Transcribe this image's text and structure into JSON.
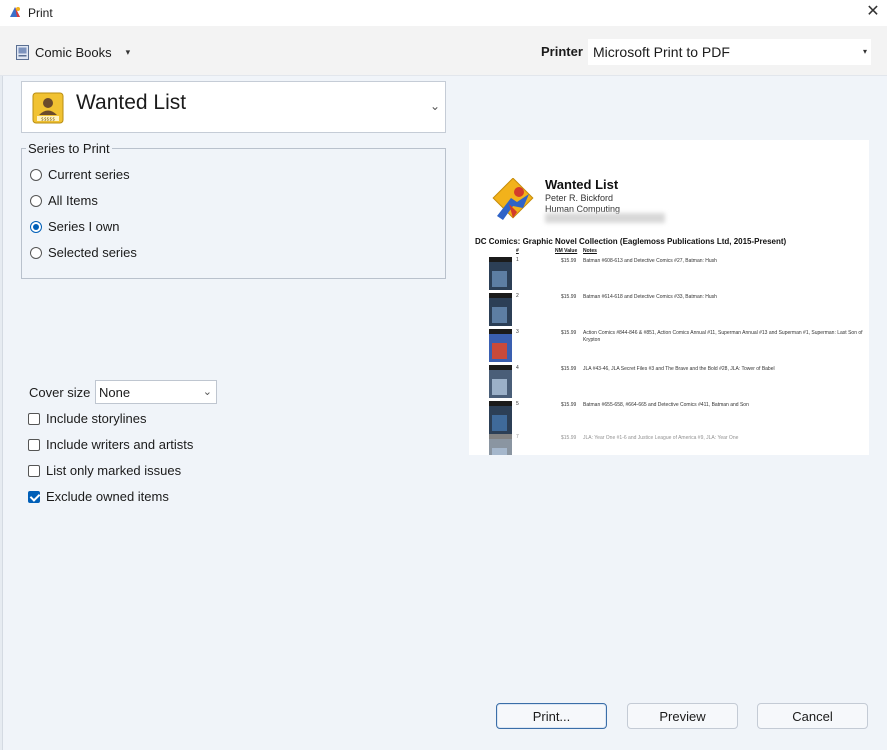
{
  "window": {
    "title": "Print",
    "close_glyph": "✕"
  },
  "toolbar": {
    "collection_label": "Comic Books",
    "collection_caret": "▾",
    "printer_label": "Printer",
    "printer_value": "Microsoft Print to PDF",
    "printer_caret": "▾"
  },
  "report": {
    "selected": "Wanted List",
    "caret": "⌄"
  },
  "series_to_print": {
    "title": "Series to Print",
    "options": [
      {
        "label": "Current series",
        "selected": false
      },
      {
        "label": "All Items",
        "selected": false
      },
      {
        "label": "Series I own",
        "selected": true
      },
      {
        "label": "Selected series",
        "selected": false
      }
    ]
  },
  "options": {
    "cover_size_label": "Cover size",
    "cover_size_value": "None",
    "cover_caret": "⌄",
    "checkboxes": [
      {
        "label": "Include storylines",
        "checked": false
      },
      {
        "label": "Include writers and artists",
        "checked": false
      },
      {
        "label": "List only marked issues",
        "checked": false
      },
      {
        "label": "Exclude owned items",
        "checked": true
      }
    ]
  },
  "preview": {
    "title": "Wanted List",
    "author": "Peter R. Bickford",
    "company": "Human Computing",
    "group_heading": "DC Comics: Graphic Novel Collection (Eaglemoss Publications Ltd, 2015-Present)",
    "col_num": "#",
    "col_value": "NM Value",
    "col_notes": "Notes",
    "rows": [
      {
        "num": "1",
        "price": "$15.99",
        "note": "Batman #608-613 and Detective Comics #27, Batman: Hush",
        "cover_text": "BATMAN"
      },
      {
        "num": "2",
        "price": "$15.99",
        "note": "Batman #614-618 and Detective Comics #33, Batman: Hush",
        "cover_text": "BATMAN"
      },
      {
        "num": "3",
        "price": "$15.99",
        "note": "Action Comics #844-846 & #851, Action Comics Annual #11, Superman Annual #13 and Superman #1, Superman: Last Son of Krypton",
        "cover_text": "SUPERMAN"
      },
      {
        "num": "4",
        "price": "$15.99",
        "note": "JLA #43-46, JLA Secret Files #3 and The Brave and the Bold #28, JLA: Tower of Babel",
        "cover_text": ""
      },
      {
        "num": "5",
        "price": "$15.99",
        "note": "Batman #655-658, #664-665 and Detective Comics #411, Batman and Son",
        "cover_text": "BATMAN"
      },
      {
        "num": "7",
        "price": "$15.99",
        "note": "JLA: Year One #1-6 and Justice League of America #9, JLA: Year One",
        "cover_text": "BATMAN"
      }
    ]
  },
  "buttons": {
    "print": "Print...",
    "preview": "Preview",
    "cancel": "Cancel"
  },
  "colors": {
    "accent": "#005fb8",
    "background": "#f0f4f9"
  }
}
